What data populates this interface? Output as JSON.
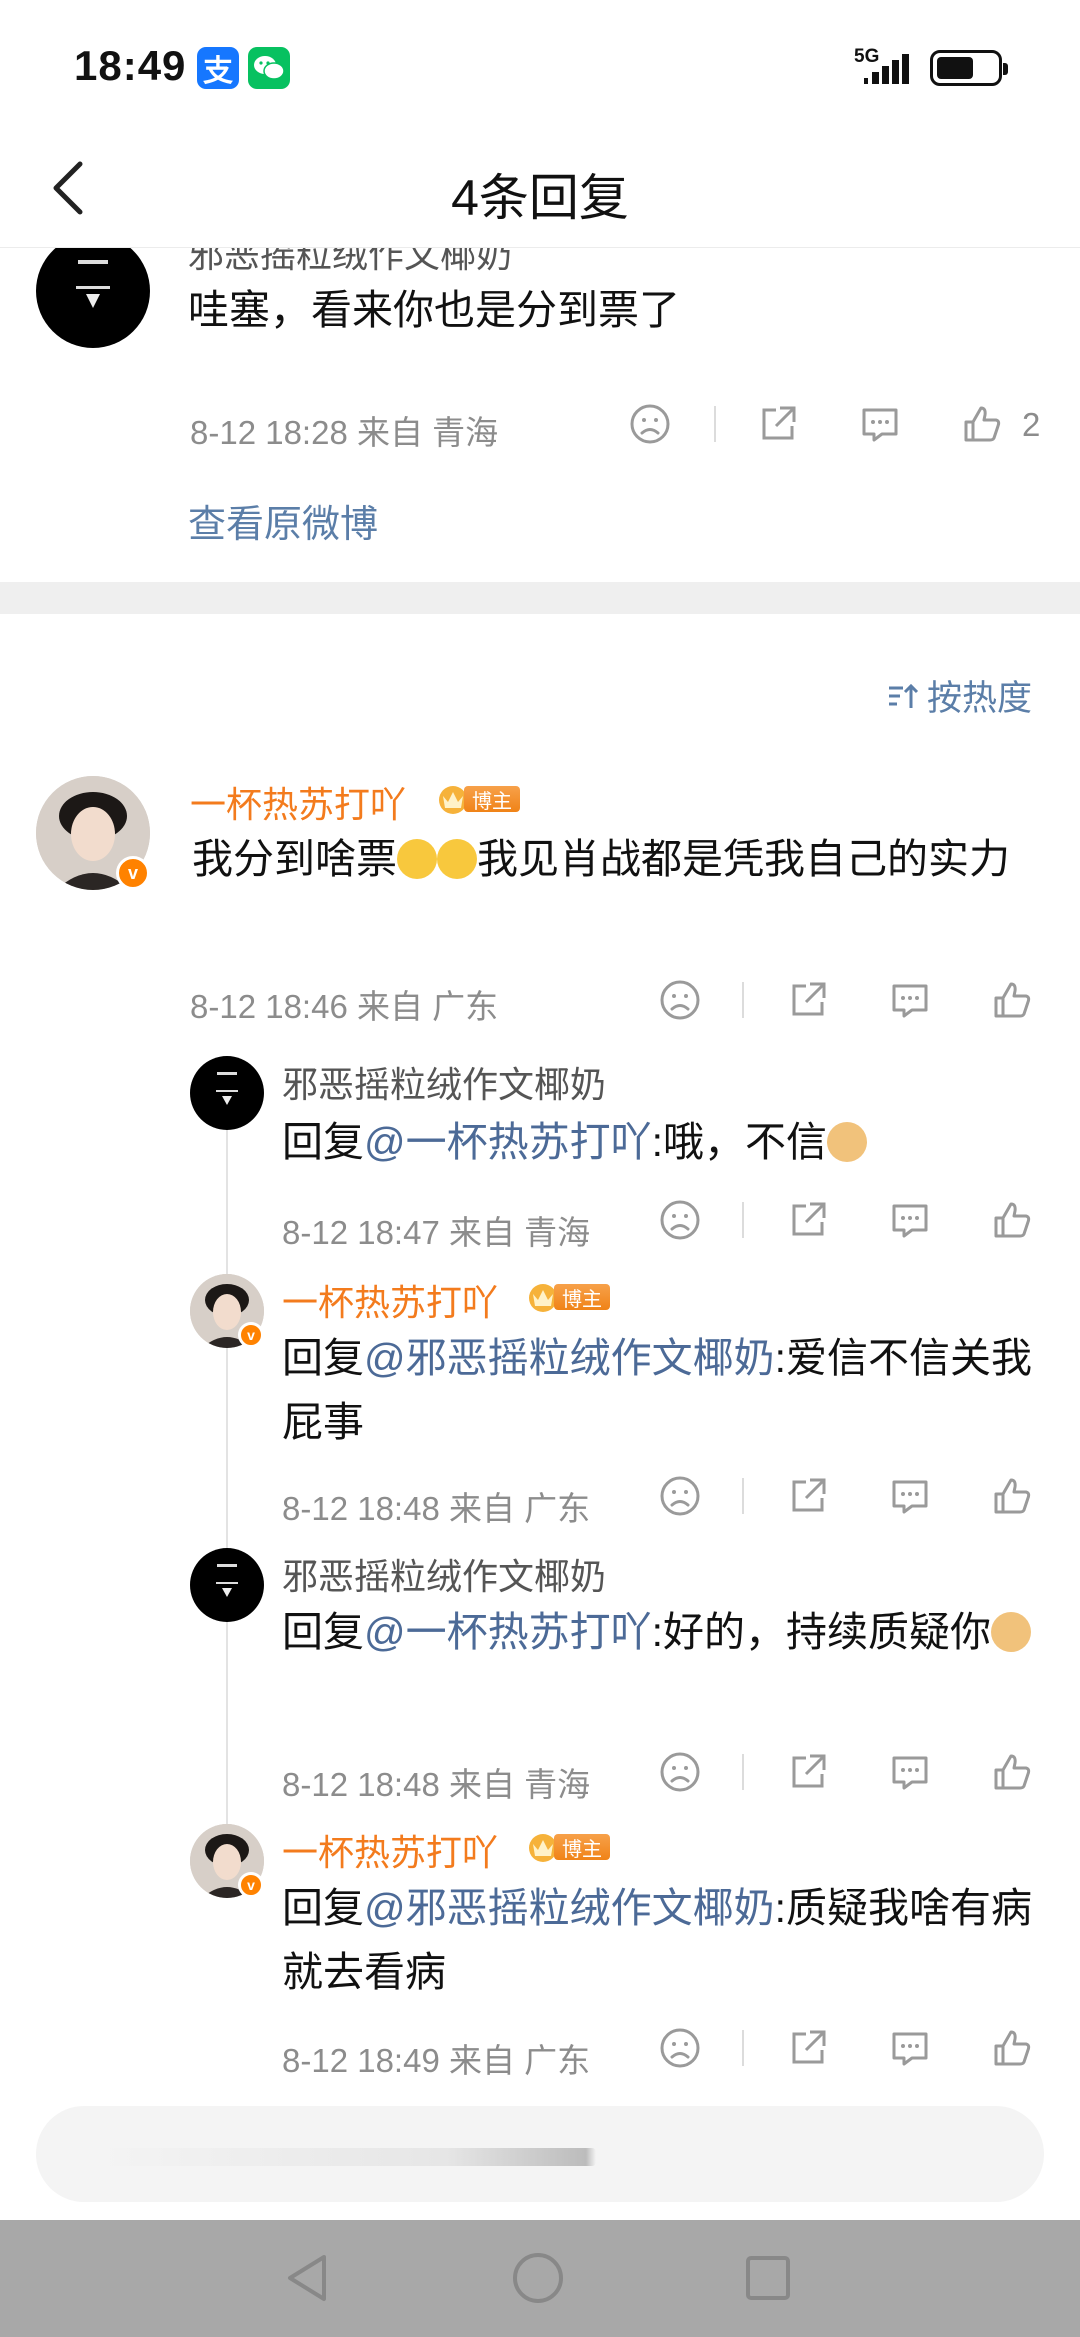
{
  "status_bar": {
    "time": "18:49",
    "network": "5G",
    "alipay_glyph": "支",
    "wechat_glyph": "✓"
  },
  "header": {
    "title": "4条回复"
  },
  "original_comment": {
    "user": "邪恶摇粒绒作文椰奶",
    "text": "哇塞，看来你也是分到票了",
    "meta": "8-12 18:28  来自 青海",
    "like_count": "2",
    "view_original": "查看原微博"
  },
  "sort": {
    "label": "按热度"
  },
  "main_comment": {
    "user": "一杯热苏打吖",
    "badge": "博主",
    "text_before": "我分到啥票",
    "text_after": "我见肖战都是凭我自己的实力",
    "meta": "8-12 18:46  来自 广东"
  },
  "replies": [
    {
      "user": "邪恶摇粒绒作文椰奶",
      "reply_prefix": "回复",
      "mention": "@一杯热苏打吖",
      "text": ":哦，不信",
      "meta": "8-12 18:47  来自 青海"
    },
    {
      "user": "一杯热苏打吖",
      "badge": "博主",
      "reply_prefix": "回复",
      "mention": "@邪恶摇粒绒作文椰奶",
      "text": ":爱信不信关我屁事",
      "meta": "8-12 18:48  来自 广东"
    },
    {
      "user": "邪恶摇粒绒作文椰奶",
      "reply_prefix": "回复",
      "mention": "@一杯热苏打吖",
      "text": ":好的，持续质疑你",
      "meta": "8-12 18:48  来自 青海"
    },
    {
      "user": "一杯热苏打吖",
      "badge": "博主",
      "reply_prefix": "回复",
      "mention": "@邪恶摇粒绒作文椰奶",
      "text": ":质疑我啥有病就去看病",
      "meta": "8-12 18:49  来自 广东"
    }
  ],
  "colors": {
    "accent_orange": "#f37b1d",
    "link_blue": "#5b7ea8",
    "mention_blue": "#4c6a97",
    "meta_gray": "#8c8c8c"
  },
  "icons": [
    "back-arrow-icon",
    "dislike-face-icon",
    "share-icon",
    "comment-icon",
    "like-thumb-icon",
    "sort-icon",
    "crown-icon",
    "verified-v-icon",
    "nav-back-icon",
    "nav-home-icon",
    "nav-recent-icon"
  ]
}
